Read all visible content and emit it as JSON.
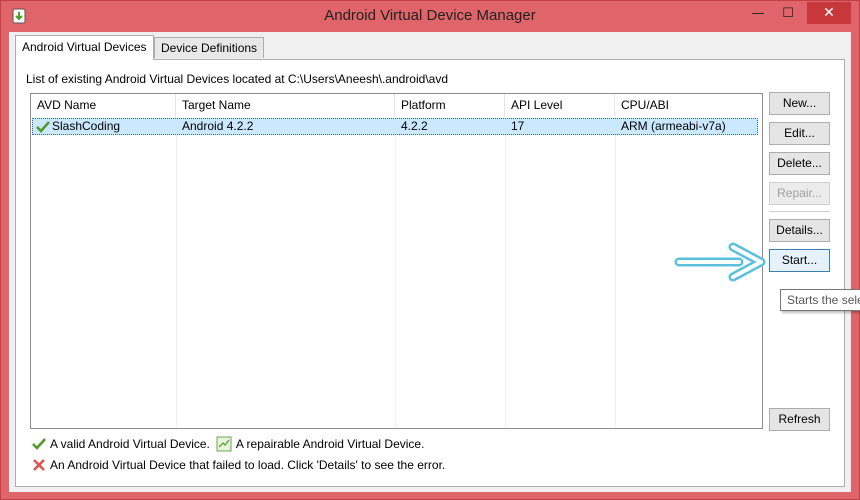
{
  "window": {
    "title": "Android Virtual Device Manager",
    "close_glyph": "✕",
    "minimize_glyph": "—",
    "maximize_glyph": "☐"
  },
  "tabs": [
    {
      "label": "Android Virtual Devices",
      "active": true
    },
    {
      "label": "Device Definitions",
      "active": false
    }
  ],
  "location_text": "List of existing Android Virtual Devices located at C:\\Users\\Aneesh\\.android\\avd",
  "table": {
    "columns": [
      "AVD Name",
      "Target Name",
      "Platform",
      "API Level",
      "CPU/ABI"
    ],
    "rows": [
      {
        "name": "SlashCoding",
        "target": "Android 4.2.2",
        "platform": "4.2.2",
        "api": "17",
        "abi": "ARM (armeabi-v7a)",
        "status_icon": "check-icon"
      }
    ]
  },
  "buttons": {
    "new": "New...",
    "edit": "Edit...",
    "delete": "Delete...",
    "repair": "Repair...",
    "details": "Details...",
    "start": "Start...",
    "refresh": "Refresh"
  },
  "tooltip": "Starts the selected AVD.",
  "legend": {
    "valid": "A valid Android Virtual Device.",
    "repairable": "A repairable Android Virtual Device.",
    "failed": "An Android Virtual Device that failed to load. Click 'Details' to see the error."
  },
  "colors": {
    "title_bar": "#e0656a",
    "close_button": "#c7383c",
    "selection": "#cce8ff",
    "valid_check": "#4c9a2a",
    "failed_x": "#d9534f",
    "annotation_arrow": "#5bc0de"
  }
}
